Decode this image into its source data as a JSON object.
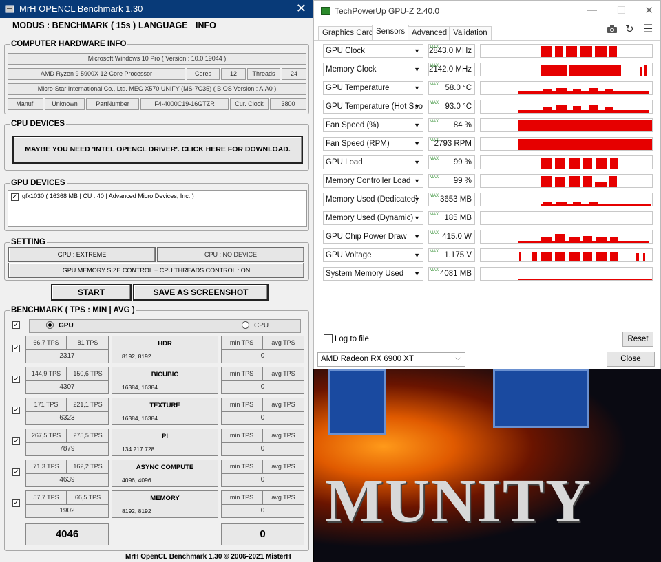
{
  "mrh": {
    "title": "MrH OPENCL Benchmark 1.30",
    "menu": {
      "modus": "MODUS : BENCHMARK ( 15s )",
      "language": "LANGUAGE",
      "info": "INFO"
    },
    "hw": {
      "title": "COMPUTER HARDWARE INFO",
      "os": "Microsoft Windows 10 Pro ( Version : 10.0.19044 )",
      "cpu": "AMD Ryzen 9 5900X 12-Core Processor",
      "cores_label": "Cores",
      "cores": "12",
      "threads_label": "Threads",
      "threads": "24",
      "board": "Micro-Star International Co., Ltd. MEG X570 UNIFY (MS-7C35) ( BIOS Version : A.A0 )",
      "manuf_label": "Manuf.",
      "manuf": "Unknown",
      "part_label": "PartNumber",
      "part": "F4-4000C19-16GTZR",
      "clock_label": "Cur. Clock",
      "clock": "3800"
    },
    "cpu_devices": {
      "title": "CPU DEVICES",
      "button": "MAYBE YOU NEED 'INTEL OPENCL DRIVER'. CLICK HERE FOR DOWNLOAD."
    },
    "gpu_devices": {
      "title": "GPU DEVICES",
      "item": "gfx1030 ( 16368 MB | CU : 40 | Advanced Micro Devices, Inc. )"
    },
    "setting": {
      "title": "SETTING",
      "gpu": "GPU : EXTREME",
      "cpu": "CPU : NO DEVICE",
      "memory": "GPU MEMORY SIZE CONTROL + CPU THREADS CONTROL : ON"
    },
    "start": "START",
    "screenshot": "SAVE AS SCREENSHOT",
    "bench": {
      "title": "BENCHMARK ( TPS : MIN | AVG )",
      "gpu": "GPU",
      "cpu": "CPU",
      "rows": [
        {
          "min": "66,7 TPS",
          "avg": "81 TPS",
          "score": "2317",
          "name": "HDR",
          "size": "8192, 8192",
          "cmin": "min TPS",
          "cavg": "avg TPS",
          "cscore": "0"
        },
        {
          "min": "144,9 TPS",
          "avg": "150,6 TPS",
          "score": "4307",
          "name": "BICUBIC",
          "size": "16384, 16384",
          "cmin": "min TPS",
          "cavg": "avg TPS",
          "cscore": "0"
        },
        {
          "min": "171 TPS",
          "avg": "221,1 TPS",
          "score": "6323",
          "name": "TEXTURE",
          "size": "16384, 16384",
          "cmin": "min TPS",
          "cavg": "avg TPS",
          "cscore": "0"
        },
        {
          "min": "267,5 TPS",
          "avg": "275,5 TPS",
          "score": "7879",
          "name": "PI",
          "size": "134.217.728",
          "cmin": "min TPS",
          "cavg": "avg TPS",
          "cscore": "0"
        },
        {
          "min": "71,3 TPS",
          "avg": "162,2 TPS",
          "score": "4639",
          "name": "ASYNC COMPUTE",
          "size": "4096, 4096",
          "cmin": "min TPS",
          "cavg": "avg TPS",
          "cscore": "0"
        },
        {
          "min": "57,7 TPS",
          "avg": "66,5 TPS",
          "score": "1902",
          "name": "MEMORY",
          "size": "8192, 8192",
          "cmin": "min TPS",
          "cavg": "avg TPS",
          "cscore": "0"
        }
      ],
      "total_gpu": "4046",
      "total_cpu": "0"
    },
    "footer": "MrH OpenCL Benchmark 1.30  ©  2006-2021 MisterH"
  },
  "gpuz": {
    "title": "TechPowerUp GPU-Z 2.40.0",
    "tabs": [
      "Graphics Card",
      "Sensors",
      "Advanced",
      "Validation"
    ],
    "max_tag": "MAX",
    "sensors": [
      {
        "name": "GPU Clock",
        "value": "2843.0 MHz"
      },
      {
        "name": "Memory Clock",
        "value": "2142.0 MHz"
      },
      {
        "name": "GPU Temperature",
        "value": "58.0 °C"
      },
      {
        "name": "GPU Temperature (Hot Spot)",
        "value": "93.0 °C"
      },
      {
        "name": "Fan Speed (%)",
        "value": "84 %"
      },
      {
        "name": "Fan Speed (RPM)",
        "value": "2793 RPM"
      },
      {
        "name": "GPU Load",
        "value": "99 %"
      },
      {
        "name": "Memory Controller Load",
        "value": "99 %"
      },
      {
        "name": "Memory Used (Dedicated)",
        "value": "3653 MB"
      },
      {
        "name": "Memory Used (Dynamic)",
        "value": "185 MB"
      },
      {
        "name": "GPU Chip Power Draw",
        "value": "415.0 W"
      },
      {
        "name": "GPU Voltage",
        "value": "1.175 V"
      },
      {
        "name": "System Memory Used",
        "value": "4081 MB"
      }
    ],
    "log_label": "Log to file",
    "reset": "Reset",
    "card": "AMD Radeon RX 6900 XT",
    "close": "Close",
    "graph_color": "#e60000"
  },
  "background": {
    "text": "MUNITY"
  }
}
